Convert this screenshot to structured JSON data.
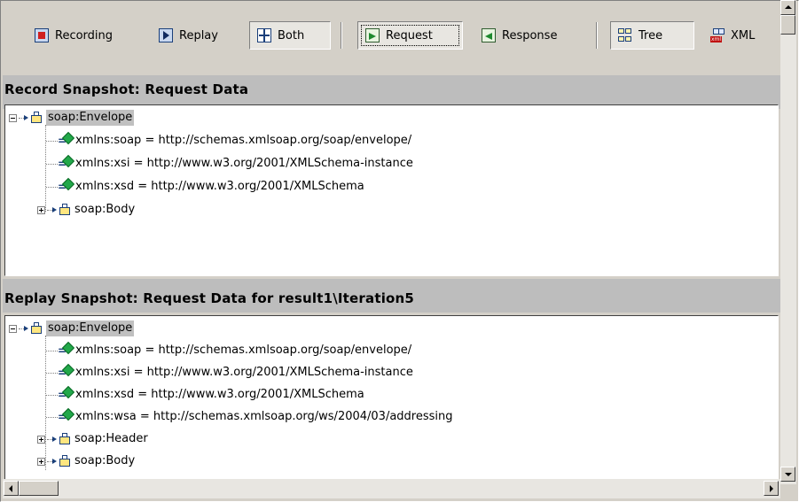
{
  "toolbar": {
    "recording_label": "Recording",
    "replay_label": "Replay",
    "both_label": "Both",
    "request_label": "Request",
    "response_label": "Response",
    "tree_label": "Tree",
    "xml_label": "XML"
  },
  "record_section": {
    "title": "Record Snapshot: Request Data",
    "rows": [
      "soap:Envelope",
      "xmlns:soap = http://schemas.xmlsoap.org/soap/envelope/",
      "xmlns:xsi = http://www.w3.org/2001/XMLSchema-instance",
      "xmlns:xsd = http://www.w3.org/2001/XMLSchema",
      "soap:Body"
    ]
  },
  "replay_section": {
    "title": "Replay Snapshot: Request Data for result1\\Iteration5",
    "rows": [
      "soap:Envelope",
      "xmlns:soap = http://schemas.xmlsoap.org/soap/envelope/",
      "xmlns:xsi = http://www.w3.org/2001/XMLSchema-instance",
      "xmlns:xsd = http://www.w3.org/2001/XMLSchema",
      "xmlns:wsa = http://schemas.xmlsoap.org/ws/2004/03/addressing",
      "soap:Header",
      "soap:Body"
    ]
  },
  "icons": {
    "recording": "recording-icon",
    "replay": "replay-icon",
    "both": "both-icon",
    "request": "request-icon",
    "response": "response-icon",
    "tree": "tree-icon",
    "xml": "xml-icon",
    "element": "xml-element-icon",
    "attribute": "xml-attribute-icon"
  },
  "colors": {
    "chrome": "#d4d0c8",
    "section_strip": "#bdbdbd",
    "selection": "#c0c0c0",
    "attribute_gem": "#22a84a"
  }
}
